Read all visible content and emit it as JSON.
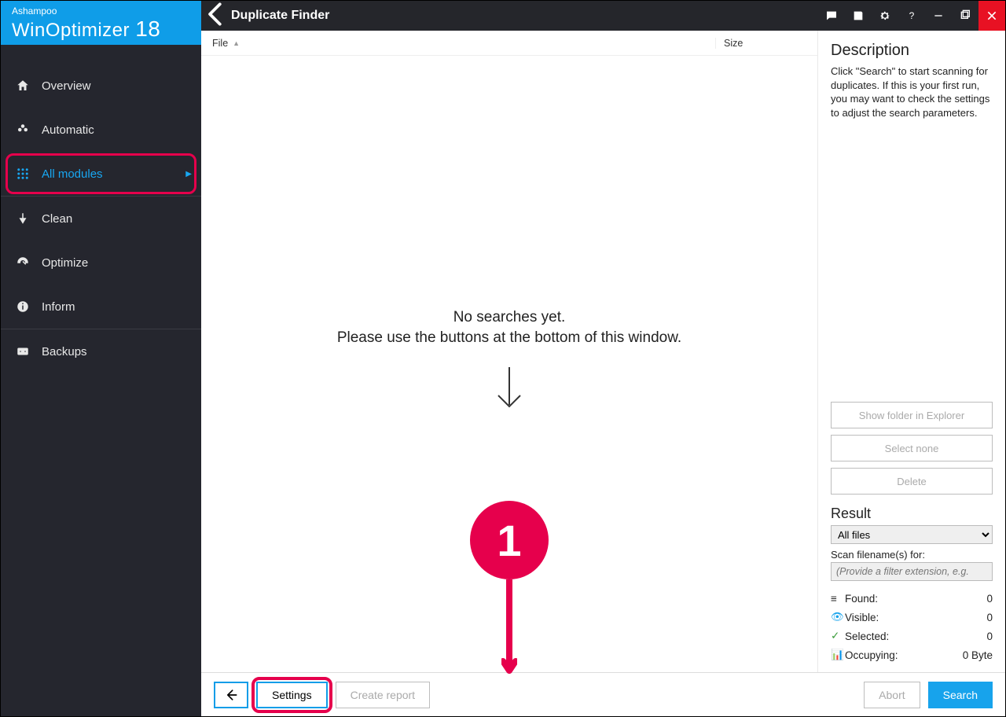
{
  "brand": {
    "line1": "Ashampoo",
    "name": "WinOptimizer",
    "version": "18"
  },
  "title": "Duplicate Finder",
  "sidebar": {
    "items": [
      {
        "label": "Overview"
      },
      {
        "label": "Automatic"
      },
      {
        "label": "All modules"
      },
      {
        "label": "Clean"
      },
      {
        "label": "Optimize"
      },
      {
        "label": "Inform"
      },
      {
        "label": "Backups"
      }
    ]
  },
  "columns": {
    "file": "File",
    "size": "Size"
  },
  "empty": {
    "line1": "No searches yet.",
    "line2": "Please use the buttons at the bottom of this window."
  },
  "desc": {
    "heading": "Description",
    "text": "Click \"Search\" to start scanning for duplicates. If this is your first run, you may want to check the settings to adjust the search parameters.",
    "show_folder": "Show folder in Explorer",
    "select_none": "Select none",
    "delete": "Delete",
    "result_heading": "Result",
    "result_select": "All files",
    "filter_label": "Scan filename(s) for:",
    "filter_placeholder": "(Provide a filter extension, e.g.",
    "stats": {
      "found_label": "Found:",
      "found_val": "0",
      "visible_label": "Visible:",
      "visible_val": "0",
      "selected_label": "Selected:",
      "selected_val": "0",
      "occupying_label": "Occupying:",
      "occupying_val": "0 Byte"
    }
  },
  "bottom": {
    "settings": "Settings",
    "create_report": "Create report",
    "abort": "Abort",
    "search": "Search"
  },
  "callout": {
    "number": "1"
  }
}
